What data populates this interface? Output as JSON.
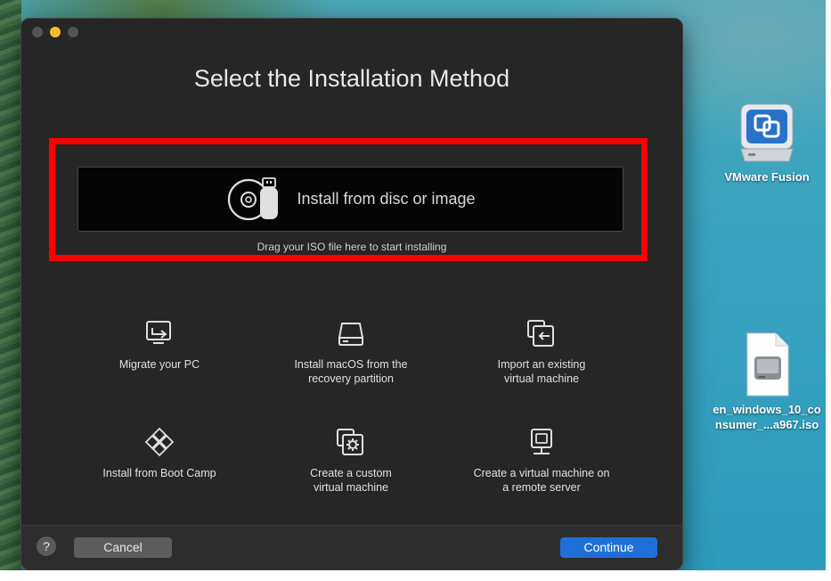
{
  "window": {
    "title": "Select the Installation Method",
    "drop_zone_label": "Install from disc or image",
    "drop_hint": "Drag your ISO file here to start installing",
    "options": [
      {
        "label": "Migrate your PC",
        "icon": "monitor-arrow-icon"
      },
      {
        "label": "Install macOS from the\nrecovery partition",
        "icon": "drive-icon"
      },
      {
        "label": "Import an existing\nvirtual machine",
        "icon": "import-vm-icon"
      },
      {
        "label": "Install from Boot Camp",
        "icon": "bootcamp-diamond-icon"
      },
      {
        "label": "Create a custom\nvirtual machine",
        "icon": "custom-vm-gear-icon"
      },
      {
        "label": "Create a virtual machine on\na remote server",
        "icon": "remote-server-icon"
      }
    ],
    "footer": {
      "help": "?",
      "cancel": "Cancel",
      "continue": "Continue"
    }
  },
  "desktop": {
    "icons": [
      {
        "label": "VMware Fusion",
        "icon": "vmware-fusion-drive-icon"
      },
      {
        "label": "en_windows_10_co\nnsumer_...a967.iso",
        "icon": "iso-disk-image-icon"
      }
    ]
  },
  "colors": {
    "highlight": "#ff0000",
    "continue_button": "#1f6fd8",
    "window_bg": "#262626"
  }
}
